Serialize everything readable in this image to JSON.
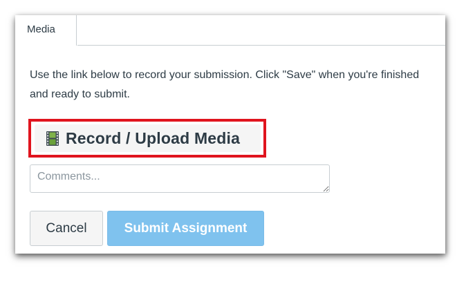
{
  "tabs": [
    {
      "label": "Media",
      "active": true
    }
  ],
  "instructions": "Use the link below to record your submission. Click \"Save\" when you're finished and ready to submit.",
  "record_button": {
    "label": "Record / Upload Media",
    "icon": "film-strip-icon"
  },
  "comments": {
    "value": "",
    "placeholder": "Comments..."
  },
  "actions": {
    "cancel_label": "Cancel",
    "submit_label": "Submit Assignment"
  },
  "colors": {
    "highlight_border": "#e0141e",
    "submit_background": "#7fc2ee",
    "text": "#2d3b45"
  }
}
